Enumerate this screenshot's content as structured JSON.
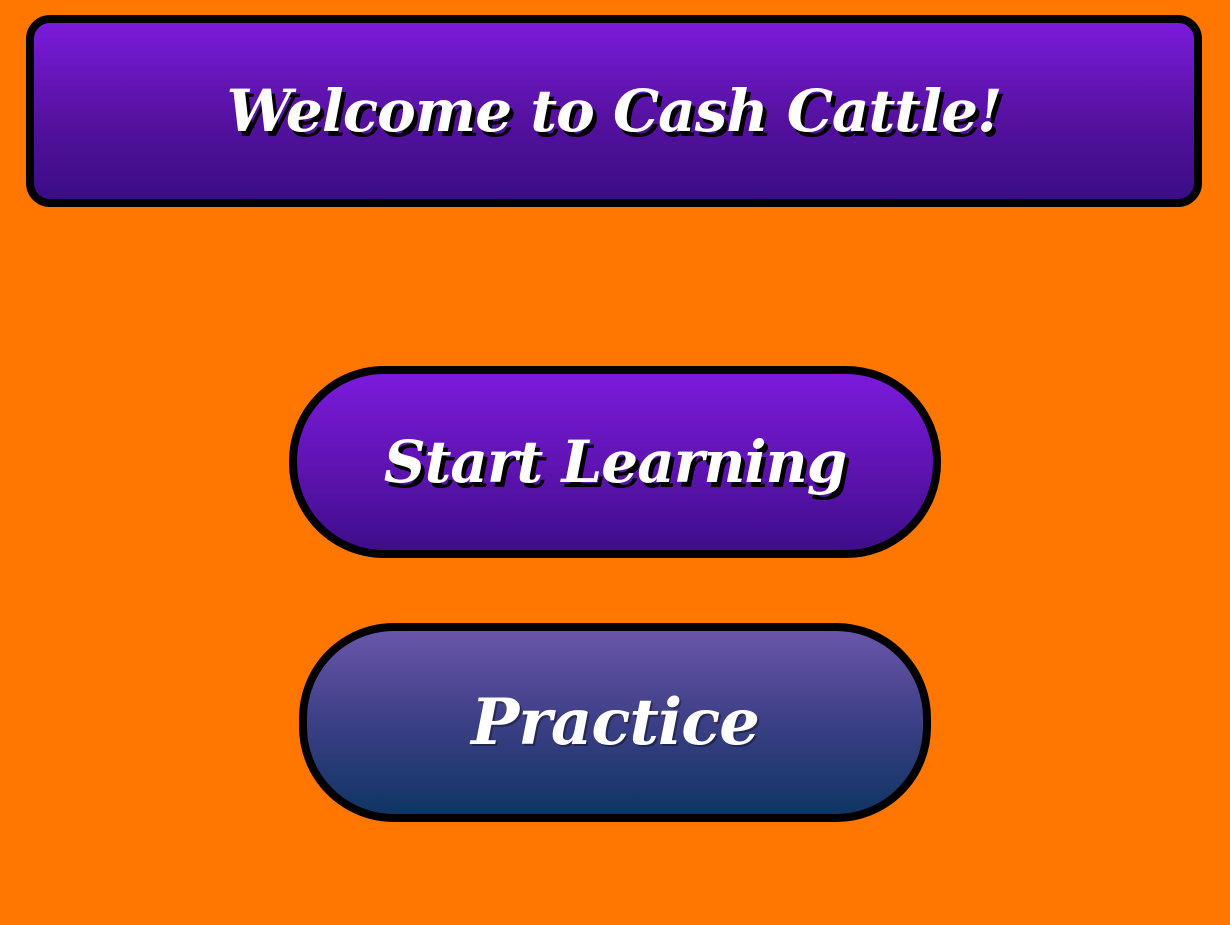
{
  "theme": {
    "background": "#ff7700",
    "primary_gradient_top": "#7b1bdc",
    "primary_gradient_bottom": "#3a0d86",
    "secondary_gradient_top": "#6a55aa",
    "secondary_gradient_bottom": "#0f3563",
    "border": "#000000",
    "text": "#ffffff"
  },
  "header": {
    "title": "Welcome to Cash Cattle!"
  },
  "menu": {
    "start_label": "Start Learning",
    "practice_label": "Practice"
  }
}
